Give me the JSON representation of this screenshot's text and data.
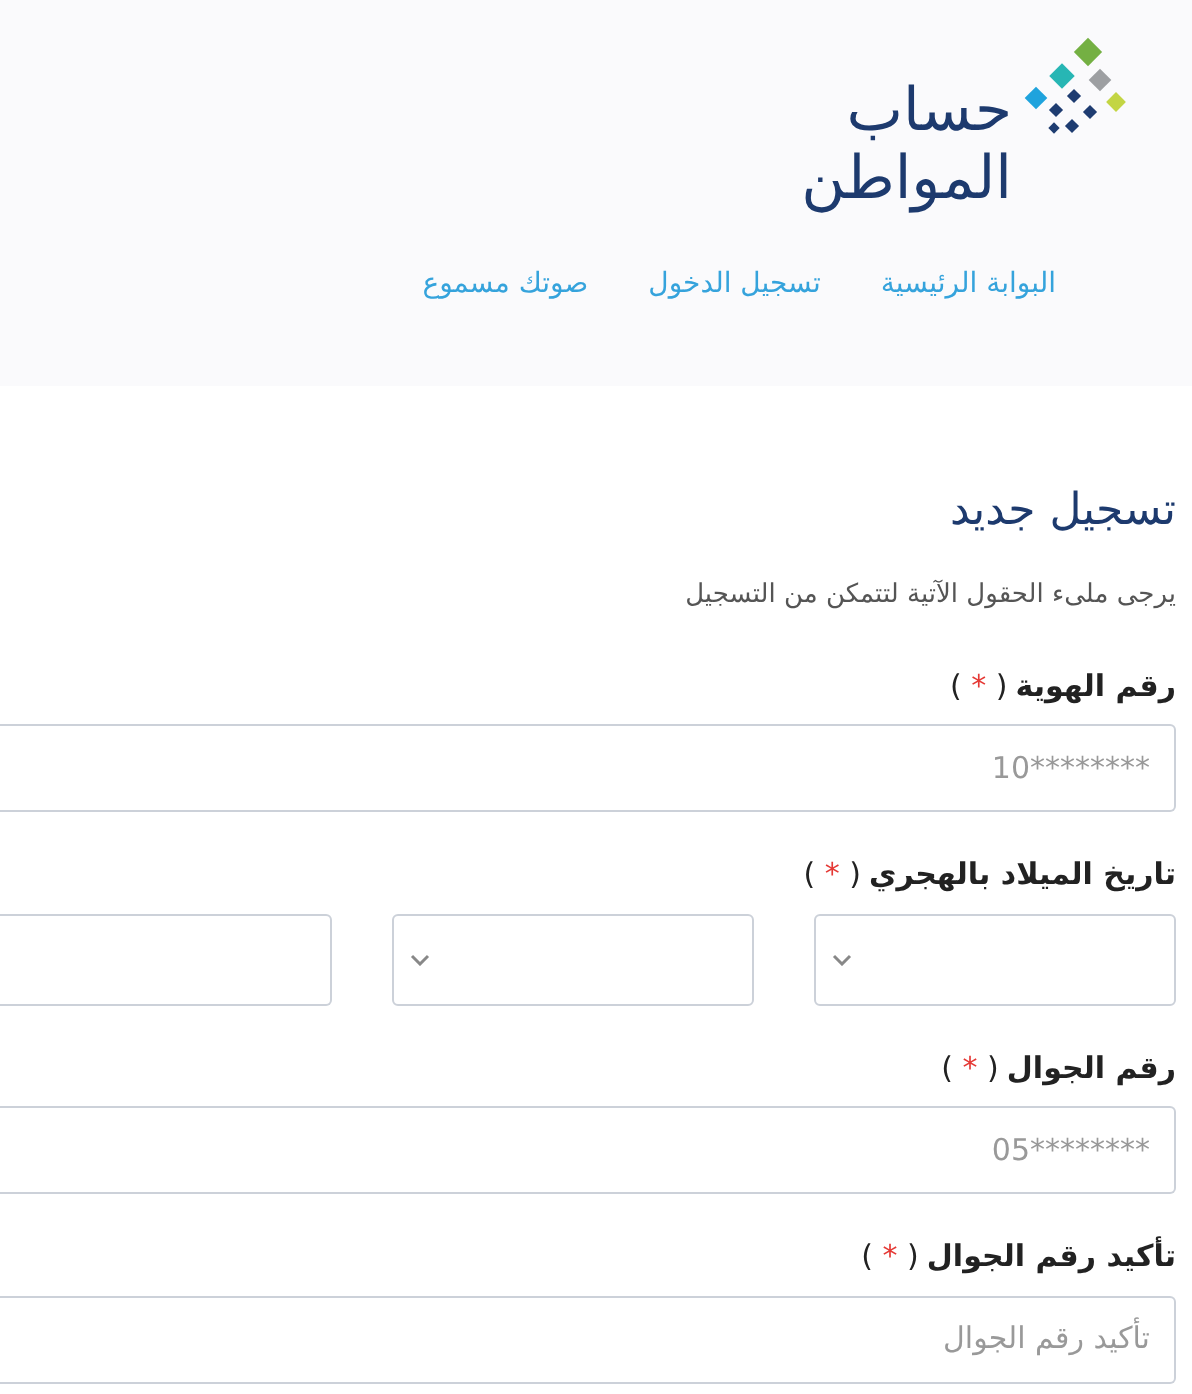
{
  "header": {
    "logo": {
      "line_1": "حساب",
      "line_2": "المواطن"
    },
    "nav": [
      {
        "label": "البوابة الرئيسية"
      },
      {
        "label": "تسجيل الدخول"
      },
      {
        "label": "صوتك مسموع"
      }
    ]
  },
  "form": {
    "title": "تسجيل جديد",
    "subtitle": "يرجى ملىء الحقول الآتية لتتمكن من التسجيل",
    "fields": [
      {
        "kind": "input",
        "label": "رقم الهوية",
        "paren_open": "(",
        "asterisk": "*",
        "paren_close": ")",
        "placeholder": "10********"
      },
      {
        "kind": "date",
        "label": "تاريخ الميلاد بالهجري",
        "paren_open": "(",
        "asterisk": "*",
        "paren_close": ")",
        "selects": [
          {
            "chevron": true
          },
          {
            "chevron": true
          },
          {
            "chevron": false
          }
        ]
      },
      {
        "kind": "input",
        "label": "رقم الجوال",
        "paren_open": "(",
        "asterisk": "*",
        "paren_close": ")",
        "placeholder": "05********"
      },
      {
        "kind": "input",
        "label": "تأكيد رقم الجوال",
        "paren_open": "(",
        "asterisk": "*",
        "paren_close": ")",
        "placeholder": "تأكيد رقم الجوال"
      }
    ]
  }
}
